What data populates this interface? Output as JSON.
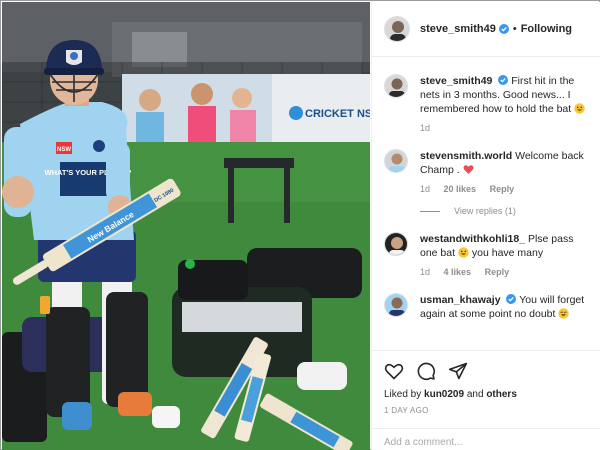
{
  "post": {
    "author": "steve_smith49",
    "follow_state": "Following",
    "caption": "First hit in the nets in 3 months. Good news... I remembered how to hold the bat",
    "caption_time": "1d",
    "photo_texts": {
      "shirt_sponsor": "WHAT'S YOUR PLAN B?",
      "shirt_badge": "NSW",
      "banner_brand": "CRICKET NSW",
      "bat_label": "New Balance",
      "bat_model": "DC 1080"
    }
  },
  "comments": [
    {
      "username": "stevensmith.world",
      "text": "Welcome back Champ .",
      "emoji": "heart-icon",
      "time": "1d",
      "likes": "20 likes",
      "reply": "Reply",
      "view_replies": "View replies (1)"
    },
    {
      "username": "westandwithkohli18_",
      "text": "Plse pass one bat",
      "text_after": "you have many",
      "emoji": "grin-emoji-icon",
      "time": "1d",
      "likes": "4 likes",
      "reply": "Reply"
    },
    {
      "username": "usman_khawajy",
      "text": "You will forget again at some point no doubt",
      "emoji": "laugh-emoji-icon"
    }
  ],
  "actions": {
    "liked_by_prefix": "Liked by",
    "liked_by_user": "kun0209",
    "liked_by_and": "and",
    "liked_by_others": "others",
    "posted_ago": "1 DAY AGO",
    "add_comment_placeholder": "Add a comment..."
  },
  "colors": {
    "verified_blue": "#3897f0",
    "heart_red": "#ed4956",
    "muted_gray": "#8e8e8e",
    "nsw_sky_blue": "#9fd3f0"
  }
}
